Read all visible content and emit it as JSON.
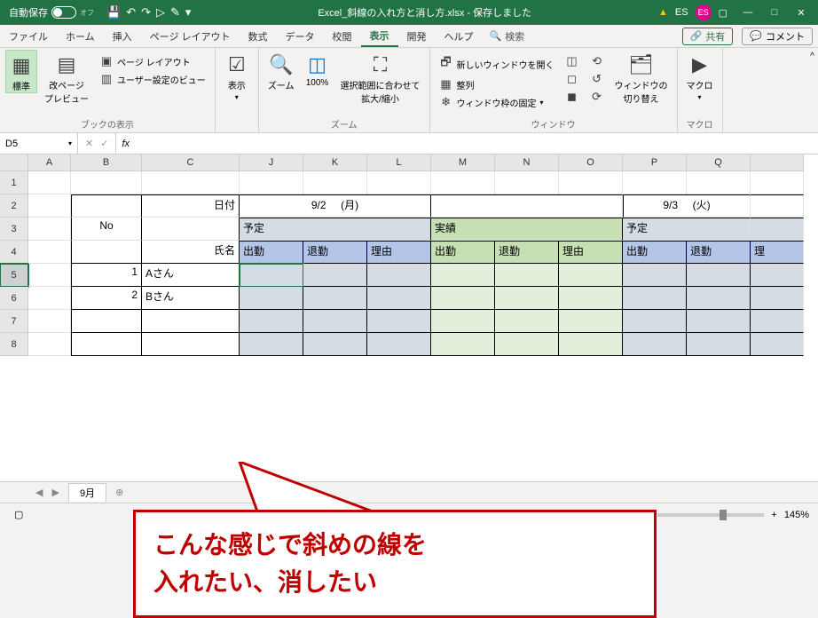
{
  "titlebar": {
    "autosave_label": "自動保存",
    "autosave_state": "オフ",
    "title": "Excel_斜線の入れ方と消し方.xlsx - 保存しました",
    "user_initials_text": "ES",
    "user_initials_badge": "ES"
  },
  "tabs": {
    "file": "ファイル",
    "home": "ホーム",
    "insert": "挿入",
    "pagelayout": "ページ レイアウト",
    "formulas": "数式",
    "data": "データ",
    "review": "校閲",
    "view": "表示",
    "developer": "開発",
    "help": "ヘルプ",
    "search": "検索",
    "share": "共有",
    "comment": "コメント"
  },
  "ribbon": {
    "views": {
      "normal": "標準",
      "pagebreak": "改ページ\nプレビュー",
      "pagelayout": "ページ レイアウト",
      "custom": "ユーザー設定のビュー",
      "group": "ブックの表示"
    },
    "show": {
      "label": "表示",
      "group": ""
    },
    "zoom": {
      "zoom": "ズーム",
      "hundred": "100%",
      "fit": "選択範囲に合わせて\n拡大/縮小",
      "group": "ズーム"
    },
    "window": {
      "newwin": "新しいウィンドウを開く",
      "arrange": "整列",
      "freeze": "ウィンドウ枠の固定",
      "switch": "ウィンドウの\n切り替え",
      "group": "ウィンドウ"
    },
    "macro": {
      "label": "マクロ",
      "group": "マクロ"
    }
  },
  "formula": {
    "namebox": "D5"
  },
  "columns": [
    "",
    "A",
    "B",
    "C",
    "J",
    "K",
    "L",
    "M",
    "N",
    "O",
    "P",
    "Q",
    ""
  ],
  "rownums": [
    "1",
    "2",
    "3",
    "4",
    "5",
    "6",
    "7",
    "8"
  ],
  "cells": {
    "c_date": "日付",
    "c_name": "氏名",
    "no": "No",
    "d92": "9/2",
    "mon": "(月)",
    "d93": "9/3",
    "tue": "(火)",
    "plan": "予定",
    "actual": "実績",
    "in": "出勤",
    "out": "退勤",
    "reason": "理由",
    "r1": "1",
    "r2": "2",
    "a": "Aさん",
    "b": "Bさん",
    "ri_partial": "理"
  },
  "callout": {
    "line1": "こんな感じで斜めの線を",
    "line2": "入れたい、消したい"
  },
  "sheettab": "9月",
  "status": {
    "zoom": "145%"
  }
}
